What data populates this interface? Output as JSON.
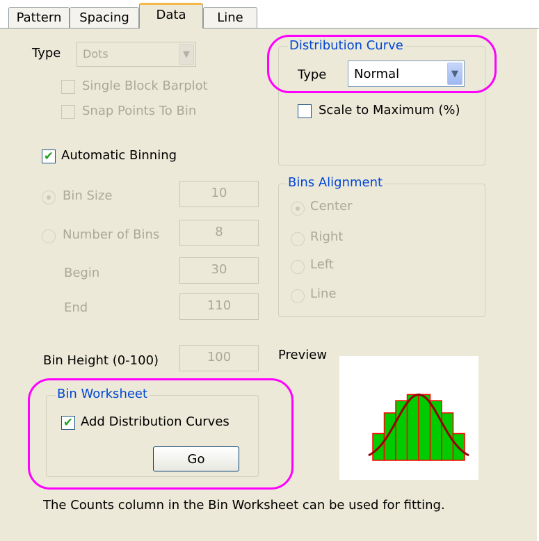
{
  "tabs": [
    {
      "label": "Pattern",
      "active": false
    },
    {
      "label": "Spacing",
      "active": false
    },
    {
      "label": "Data",
      "active": true
    },
    {
      "label": "Line",
      "active": false
    }
  ],
  "left": {
    "type_label": "Type",
    "type_value": "Dots",
    "single_block_label": "Single Block Barplot",
    "snap_points_label": "Snap Points To Bin",
    "auto_binning_label": "Automatic Binning",
    "auto_binning_checked": true,
    "bin_size_label": "Bin Size",
    "bin_size_value": "10",
    "num_bins_label": "Number of Bins",
    "num_bins_value": "8",
    "begin_label": "Begin",
    "begin_value": "30",
    "end_label": "End",
    "end_value": "110",
    "bin_height_label": "Bin Height (0-100)",
    "bin_height_value": "100"
  },
  "distribution_curve": {
    "title": "Distribution Curve",
    "type_label": "Type",
    "type_value": "Normal",
    "scale_label": "Scale to Maximum (%)",
    "scale_checked": false
  },
  "bins_alignment": {
    "title": "Bins Alignment",
    "options": [
      "Center",
      "Right",
      "Left",
      "Line"
    ],
    "selected": "Center"
  },
  "bin_worksheet": {
    "title": "Bin Worksheet",
    "add_curves_label": "Add Distribution Curves",
    "add_curves_checked": true,
    "go_label": "Go"
  },
  "preview": {
    "label": "Preview",
    "bars": [
      0.35,
      0.62,
      0.78,
      0.86,
      0.86,
      0.78,
      0.62,
      0.35
    ],
    "bar_color": "#00cc00",
    "bar_edge": "#ff0000",
    "curve_color": "#990000"
  },
  "footer_note": "The Counts column in the Bin Worksheet can be used for fitting.",
  "colors": {
    "dialog_bg": "#ece9d8",
    "group_title": "#0046d5",
    "highlight": "#ff00ff",
    "active_tab_accent": "#f5b84a"
  }
}
